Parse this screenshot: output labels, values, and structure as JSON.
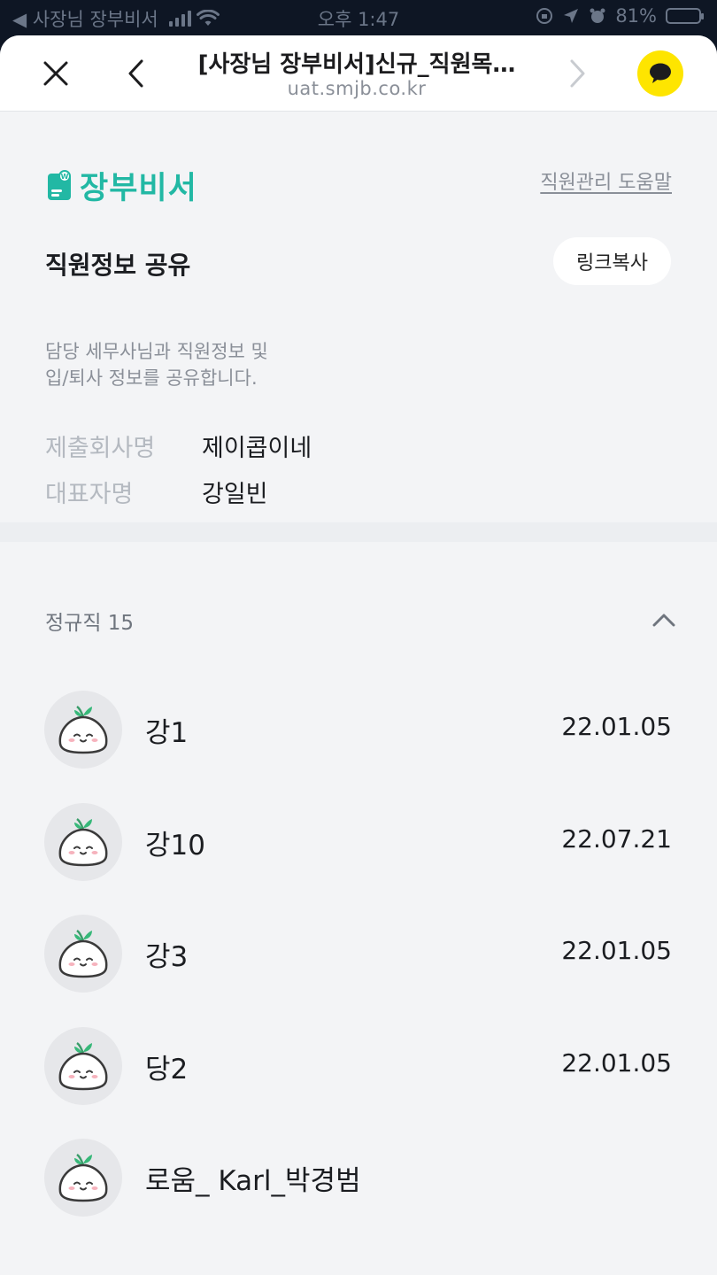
{
  "status_bar": {
    "back_app": "◀ 사장님 장부비서",
    "time": "오후 1:47",
    "battery": "81%",
    "battery_level": 0.81
  },
  "browser": {
    "title": "[사장님 장부비서]신규_직원목…",
    "url": "uat.smjb.co.kr"
  },
  "header": {
    "logo_text": "장부비서",
    "help_link": "직원관리 도움말"
  },
  "share": {
    "title": "직원정보 공유",
    "copy_link_label": "링크복사",
    "description_line1": "담당 세무사님과 직원정보 및",
    "description_line2": "입/퇴사 정보를 공유합니다."
  },
  "company": {
    "company_label": "제출회사명",
    "company_value": "제이콥이네",
    "ceo_label": "대표자명",
    "ceo_value": "강일빈"
  },
  "group": {
    "title": "정규직 15"
  },
  "employees": [
    {
      "name": "강1",
      "date": "22.01.05"
    },
    {
      "name": "강10",
      "date": "22.07.21"
    },
    {
      "name": "강3",
      "date": "22.01.05"
    },
    {
      "name": "당2",
      "date": "22.01.05"
    },
    {
      "name": "로움_ Karl_박경범",
      "date": ""
    }
  ],
  "colors": {
    "brand": "#22b8a4",
    "kakao_yellow": "#fee500",
    "background": "#f3f4f6"
  },
  "icons": {
    "close": "close-icon",
    "back": "chevron-left-icon",
    "forward": "chevron-right-icon",
    "kakao": "kakaotalk-icon",
    "collapse": "chevron-up-icon",
    "avatar": "mascot-avatar-icon"
  }
}
